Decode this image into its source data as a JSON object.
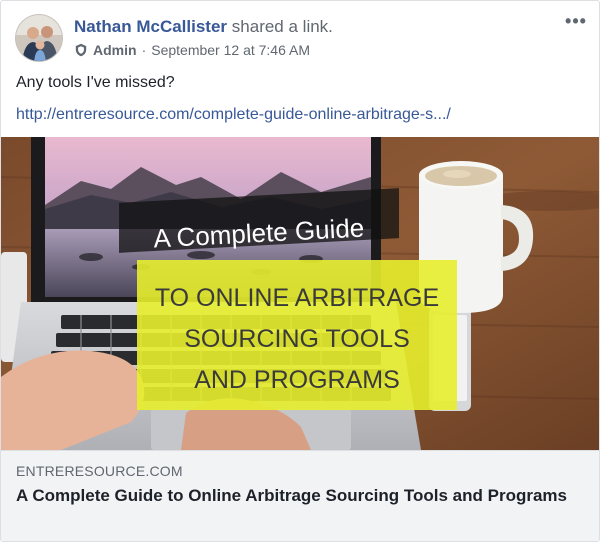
{
  "post": {
    "author": "Nathan McCallister",
    "action": "shared a link.",
    "role": "Admin",
    "separator": "·",
    "timestamp": "September 12 at 7:46 AM",
    "more_label": "•••",
    "message": "Any tools I've missed?",
    "link_url_text": "http://entreresource.com/complete-guide-online-arbitrage-s.../"
  },
  "preview": {
    "overlay_line1": "A Complete Guide",
    "overlay_line2": "TO ONLINE ARBITRAGE",
    "overlay_line3": "SOURCING TOOLS",
    "overlay_line4": "AND PROGRAMS",
    "domain": "ENTRERESOURCE.COM",
    "title": "A Complete Guide to Online Arbitrage Sourcing Tools and Programs"
  },
  "colors": {
    "link_blue": "#385898",
    "highlight_yellow": "#e7ee2c",
    "caption_bg": "#f2f3f5"
  },
  "icons": {
    "admin": "shield-icon",
    "more": "more-options-icon"
  }
}
